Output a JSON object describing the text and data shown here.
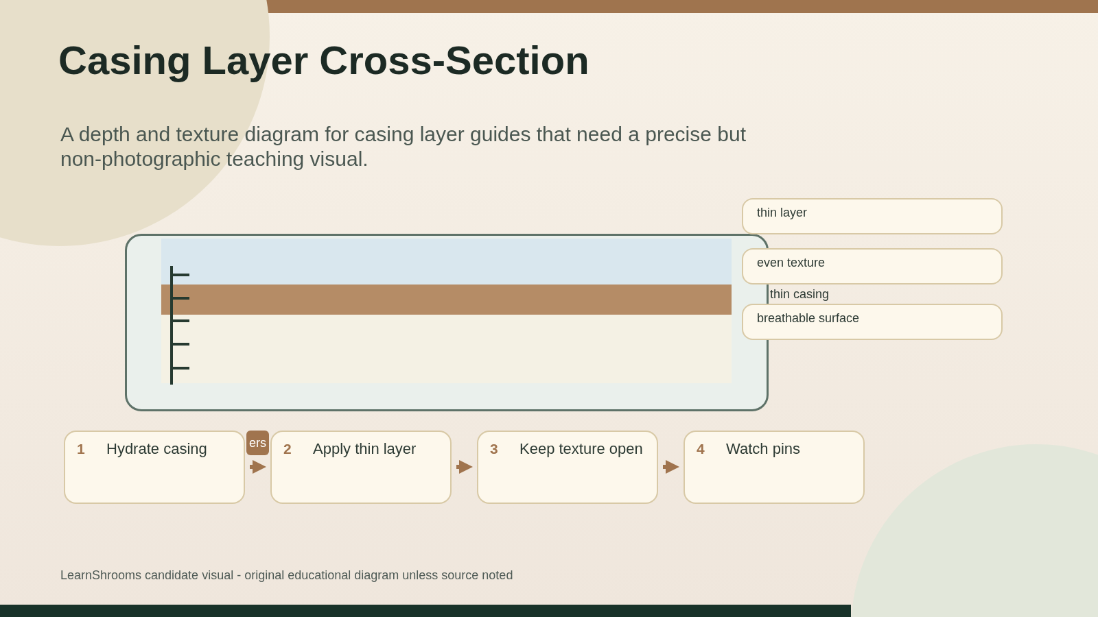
{
  "header": {
    "title": "Casing Layer Cross-Section",
    "subtitle": "A depth and texture diagram for casing layer guides that need a precise but non-photographic teaching visual."
  },
  "callouts": [
    {
      "kind": "card",
      "text": "thin layer"
    },
    {
      "kind": "card",
      "text": "even texture"
    },
    {
      "kind": "label",
      "text": "thin casing"
    },
    {
      "kind": "card",
      "text": "breathable surface"
    }
  ],
  "flow": {
    "tag": "ers",
    "steps": [
      {
        "number": "1",
        "label": "Hydrate casing"
      },
      {
        "number": "2",
        "label": "Apply thin layer"
      },
      {
        "number": "3",
        "label": "Keep texture open"
      },
      {
        "number": "4",
        "label": "Watch pins"
      }
    ]
  },
  "footer": {
    "note": "LearnShrooms candidate visual - original educational diagram unless source noted"
  }
}
